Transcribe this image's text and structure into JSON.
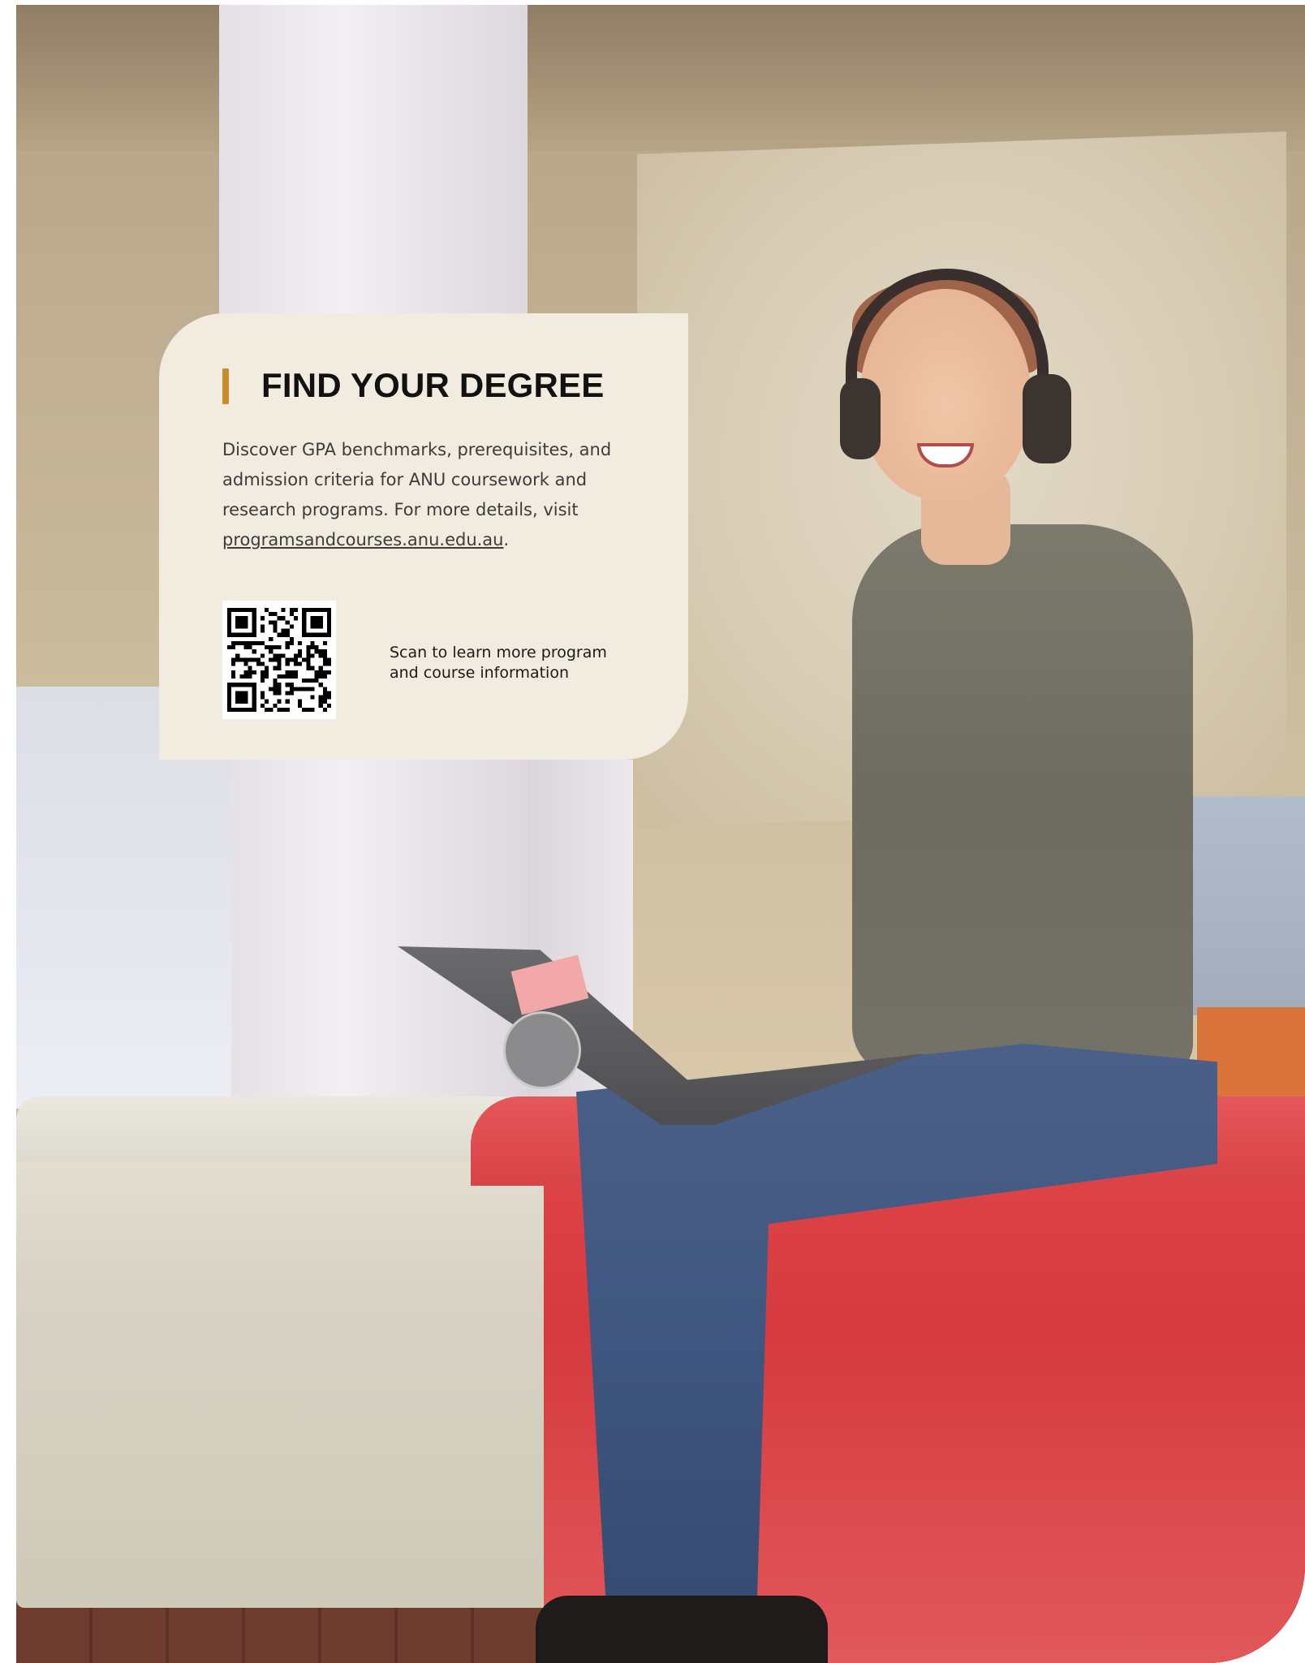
{
  "card": {
    "title": "FIND YOUR DEGREE",
    "body_text": "Discover GPA benchmarks, prerequisites, and admission criteria for ANU coursework and research programs. For more details, visit ",
    "link_text": "programsandcourses.anu.edu.au",
    "body_end": ".",
    "qr_caption": "Scan to learn more program and course information",
    "accent_color": "#c98a2e",
    "background_color": "#f2ebdf"
  },
  "photo": {
    "icon": "student-with-laptop-photo"
  }
}
